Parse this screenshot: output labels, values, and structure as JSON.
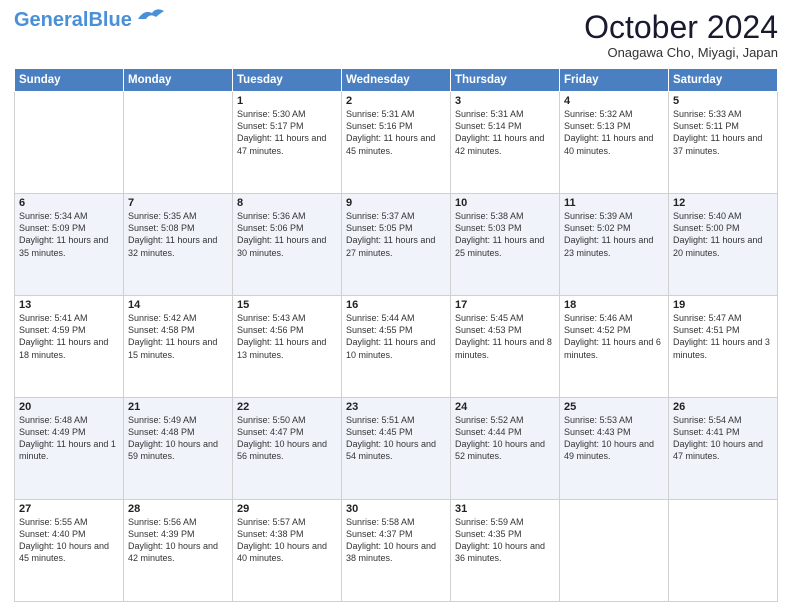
{
  "header": {
    "logo_general": "General",
    "logo_blue": "Blue",
    "month_title": "October 2024",
    "location": "Onagawa Cho, Miyagi, Japan"
  },
  "days_of_week": [
    "Sunday",
    "Monday",
    "Tuesday",
    "Wednesday",
    "Thursday",
    "Friday",
    "Saturday"
  ],
  "weeks": [
    [
      {
        "day": "",
        "sunrise": "",
        "sunset": "",
        "daylight": ""
      },
      {
        "day": "",
        "sunrise": "",
        "sunset": "",
        "daylight": ""
      },
      {
        "day": "1",
        "sunrise": "Sunrise: 5:30 AM",
        "sunset": "Sunset: 5:17 PM",
        "daylight": "Daylight: 11 hours and 47 minutes."
      },
      {
        "day": "2",
        "sunrise": "Sunrise: 5:31 AM",
        "sunset": "Sunset: 5:16 PM",
        "daylight": "Daylight: 11 hours and 45 minutes."
      },
      {
        "day": "3",
        "sunrise": "Sunrise: 5:31 AM",
        "sunset": "Sunset: 5:14 PM",
        "daylight": "Daylight: 11 hours and 42 minutes."
      },
      {
        "day": "4",
        "sunrise": "Sunrise: 5:32 AM",
        "sunset": "Sunset: 5:13 PM",
        "daylight": "Daylight: 11 hours and 40 minutes."
      },
      {
        "day": "5",
        "sunrise": "Sunrise: 5:33 AM",
        "sunset": "Sunset: 5:11 PM",
        "daylight": "Daylight: 11 hours and 37 minutes."
      }
    ],
    [
      {
        "day": "6",
        "sunrise": "Sunrise: 5:34 AM",
        "sunset": "Sunset: 5:09 PM",
        "daylight": "Daylight: 11 hours and 35 minutes."
      },
      {
        "day": "7",
        "sunrise": "Sunrise: 5:35 AM",
        "sunset": "Sunset: 5:08 PM",
        "daylight": "Daylight: 11 hours and 32 minutes."
      },
      {
        "day": "8",
        "sunrise": "Sunrise: 5:36 AM",
        "sunset": "Sunset: 5:06 PM",
        "daylight": "Daylight: 11 hours and 30 minutes."
      },
      {
        "day": "9",
        "sunrise": "Sunrise: 5:37 AM",
        "sunset": "Sunset: 5:05 PM",
        "daylight": "Daylight: 11 hours and 27 minutes."
      },
      {
        "day": "10",
        "sunrise": "Sunrise: 5:38 AM",
        "sunset": "Sunset: 5:03 PM",
        "daylight": "Daylight: 11 hours and 25 minutes."
      },
      {
        "day": "11",
        "sunrise": "Sunrise: 5:39 AM",
        "sunset": "Sunset: 5:02 PM",
        "daylight": "Daylight: 11 hours and 23 minutes."
      },
      {
        "day": "12",
        "sunrise": "Sunrise: 5:40 AM",
        "sunset": "Sunset: 5:00 PM",
        "daylight": "Daylight: 11 hours and 20 minutes."
      }
    ],
    [
      {
        "day": "13",
        "sunrise": "Sunrise: 5:41 AM",
        "sunset": "Sunset: 4:59 PM",
        "daylight": "Daylight: 11 hours and 18 minutes."
      },
      {
        "day": "14",
        "sunrise": "Sunrise: 5:42 AM",
        "sunset": "Sunset: 4:58 PM",
        "daylight": "Daylight: 11 hours and 15 minutes."
      },
      {
        "day": "15",
        "sunrise": "Sunrise: 5:43 AM",
        "sunset": "Sunset: 4:56 PM",
        "daylight": "Daylight: 11 hours and 13 minutes."
      },
      {
        "day": "16",
        "sunrise": "Sunrise: 5:44 AM",
        "sunset": "Sunset: 4:55 PM",
        "daylight": "Daylight: 11 hours and 10 minutes."
      },
      {
        "day": "17",
        "sunrise": "Sunrise: 5:45 AM",
        "sunset": "Sunset: 4:53 PM",
        "daylight": "Daylight: 11 hours and 8 minutes."
      },
      {
        "day": "18",
        "sunrise": "Sunrise: 5:46 AM",
        "sunset": "Sunset: 4:52 PM",
        "daylight": "Daylight: 11 hours and 6 minutes."
      },
      {
        "day": "19",
        "sunrise": "Sunrise: 5:47 AM",
        "sunset": "Sunset: 4:51 PM",
        "daylight": "Daylight: 11 hours and 3 minutes."
      }
    ],
    [
      {
        "day": "20",
        "sunrise": "Sunrise: 5:48 AM",
        "sunset": "Sunset: 4:49 PM",
        "daylight": "Daylight: 11 hours and 1 minute."
      },
      {
        "day": "21",
        "sunrise": "Sunrise: 5:49 AM",
        "sunset": "Sunset: 4:48 PM",
        "daylight": "Daylight: 10 hours and 59 minutes."
      },
      {
        "day": "22",
        "sunrise": "Sunrise: 5:50 AM",
        "sunset": "Sunset: 4:47 PM",
        "daylight": "Daylight: 10 hours and 56 minutes."
      },
      {
        "day": "23",
        "sunrise": "Sunrise: 5:51 AM",
        "sunset": "Sunset: 4:45 PM",
        "daylight": "Daylight: 10 hours and 54 minutes."
      },
      {
        "day": "24",
        "sunrise": "Sunrise: 5:52 AM",
        "sunset": "Sunset: 4:44 PM",
        "daylight": "Daylight: 10 hours and 52 minutes."
      },
      {
        "day": "25",
        "sunrise": "Sunrise: 5:53 AM",
        "sunset": "Sunset: 4:43 PM",
        "daylight": "Daylight: 10 hours and 49 minutes."
      },
      {
        "day": "26",
        "sunrise": "Sunrise: 5:54 AM",
        "sunset": "Sunset: 4:41 PM",
        "daylight": "Daylight: 10 hours and 47 minutes."
      }
    ],
    [
      {
        "day": "27",
        "sunrise": "Sunrise: 5:55 AM",
        "sunset": "Sunset: 4:40 PM",
        "daylight": "Daylight: 10 hours and 45 minutes."
      },
      {
        "day": "28",
        "sunrise": "Sunrise: 5:56 AM",
        "sunset": "Sunset: 4:39 PM",
        "daylight": "Daylight: 10 hours and 42 minutes."
      },
      {
        "day": "29",
        "sunrise": "Sunrise: 5:57 AM",
        "sunset": "Sunset: 4:38 PM",
        "daylight": "Daylight: 10 hours and 40 minutes."
      },
      {
        "day": "30",
        "sunrise": "Sunrise: 5:58 AM",
        "sunset": "Sunset: 4:37 PM",
        "daylight": "Daylight: 10 hours and 38 minutes."
      },
      {
        "day": "31",
        "sunrise": "Sunrise: 5:59 AM",
        "sunset": "Sunset: 4:35 PM",
        "daylight": "Daylight: 10 hours and 36 minutes."
      },
      {
        "day": "",
        "sunrise": "",
        "sunset": "",
        "daylight": ""
      },
      {
        "day": "",
        "sunrise": "",
        "sunset": "",
        "daylight": ""
      }
    ]
  ]
}
